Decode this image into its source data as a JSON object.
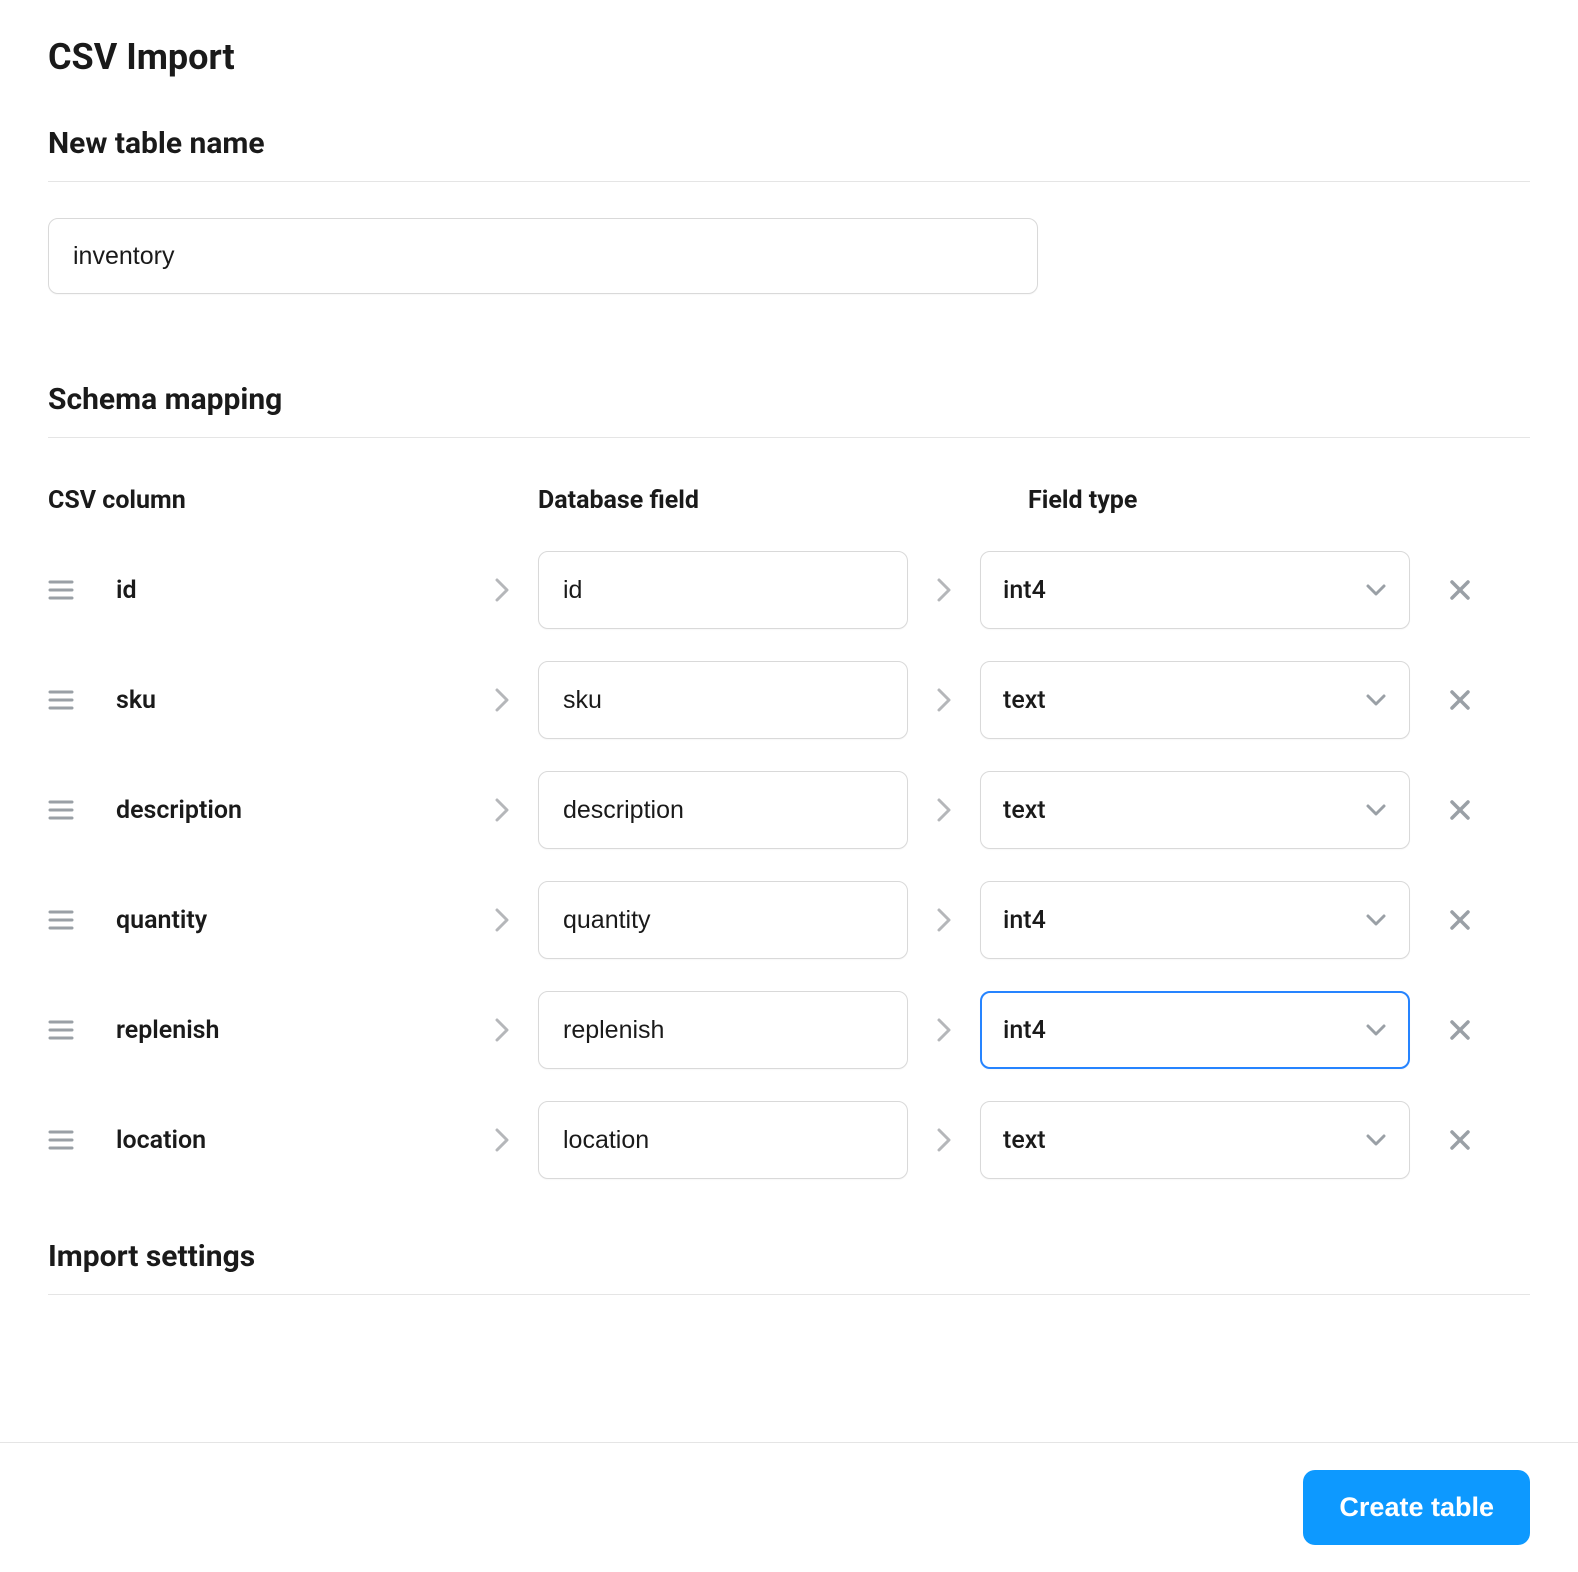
{
  "title": "CSV Import",
  "sections": {
    "table_name": {
      "heading": "New table name",
      "value": "inventory"
    },
    "schema": {
      "heading": "Schema mapping",
      "col_headers": {
        "csv": "CSV column",
        "db": "Database field",
        "type": "Field type"
      },
      "rows": [
        {
          "csv": "id",
          "db": "id",
          "type": "int4",
          "focused": false
        },
        {
          "csv": "sku",
          "db": "sku",
          "type": "text",
          "focused": false
        },
        {
          "csv": "description",
          "db": "description",
          "type": "text",
          "focused": false
        },
        {
          "csv": "quantity",
          "db": "quantity",
          "type": "int4",
          "focused": false
        },
        {
          "csv": "replenish",
          "db": "replenish",
          "type": "int4",
          "focused": true
        },
        {
          "csv": "location",
          "db": "location",
          "type": "text",
          "focused": false
        }
      ]
    },
    "import_settings": {
      "heading": "Import settings"
    }
  },
  "footer": {
    "create_label": "Create table"
  }
}
